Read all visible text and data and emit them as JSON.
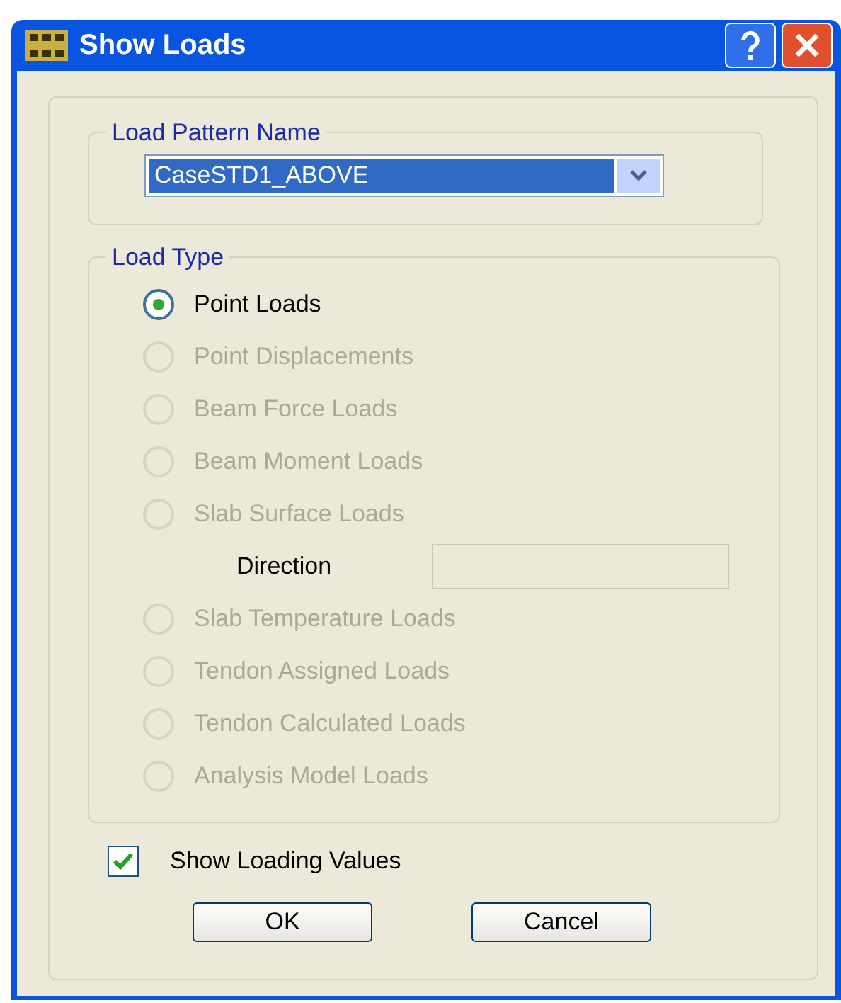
{
  "window": {
    "title": "Show Loads"
  },
  "load_pattern": {
    "label": "Load Pattern Name",
    "value": "CaseSTD1_ABOVE"
  },
  "load_type": {
    "label": "Load Type",
    "items": [
      {
        "kind": "radio",
        "label": "Point Loads",
        "selected": true,
        "disabled": false
      },
      {
        "kind": "radio",
        "label": "Point Displacements",
        "selected": false,
        "disabled": true
      },
      {
        "kind": "radio",
        "label": "Beam Force Loads",
        "selected": false,
        "disabled": true
      },
      {
        "kind": "radio",
        "label": "Beam Moment Loads",
        "selected": false,
        "disabled": true
      },
      {
        "kind": "radio",
        "label": "Slab Surface Loads",
        "selected": false,
        "disabled": true
      },
      {
        "kind": "field",
        "label": "Direction",
        "disabled": true
      },
      {
        "kind": "radio",
        "label": "Slab Temperature Loads",
        "selected": false,
        "disabled": true
      },
      {
        "kind": "radio",
        "label": "Tendon Assigned Loads",
        "selected": false,
        "disabled": true
      },
      {
        "kind": "radio",
        "label": "Tendon Calculated Loads",
        "selected": false,
        "disabled": true
      },
      {
        "kind": "radio",
        "label": "Analysis Model Loads",
        "selected": false,
        "disabled": true
      }
    ]
  },
  "show_loading_values": {
    "label": "Show Loading Values",
    "checked": true
  },
  "buttons": [
    "OK",
    "Cancel"
  ]
}
